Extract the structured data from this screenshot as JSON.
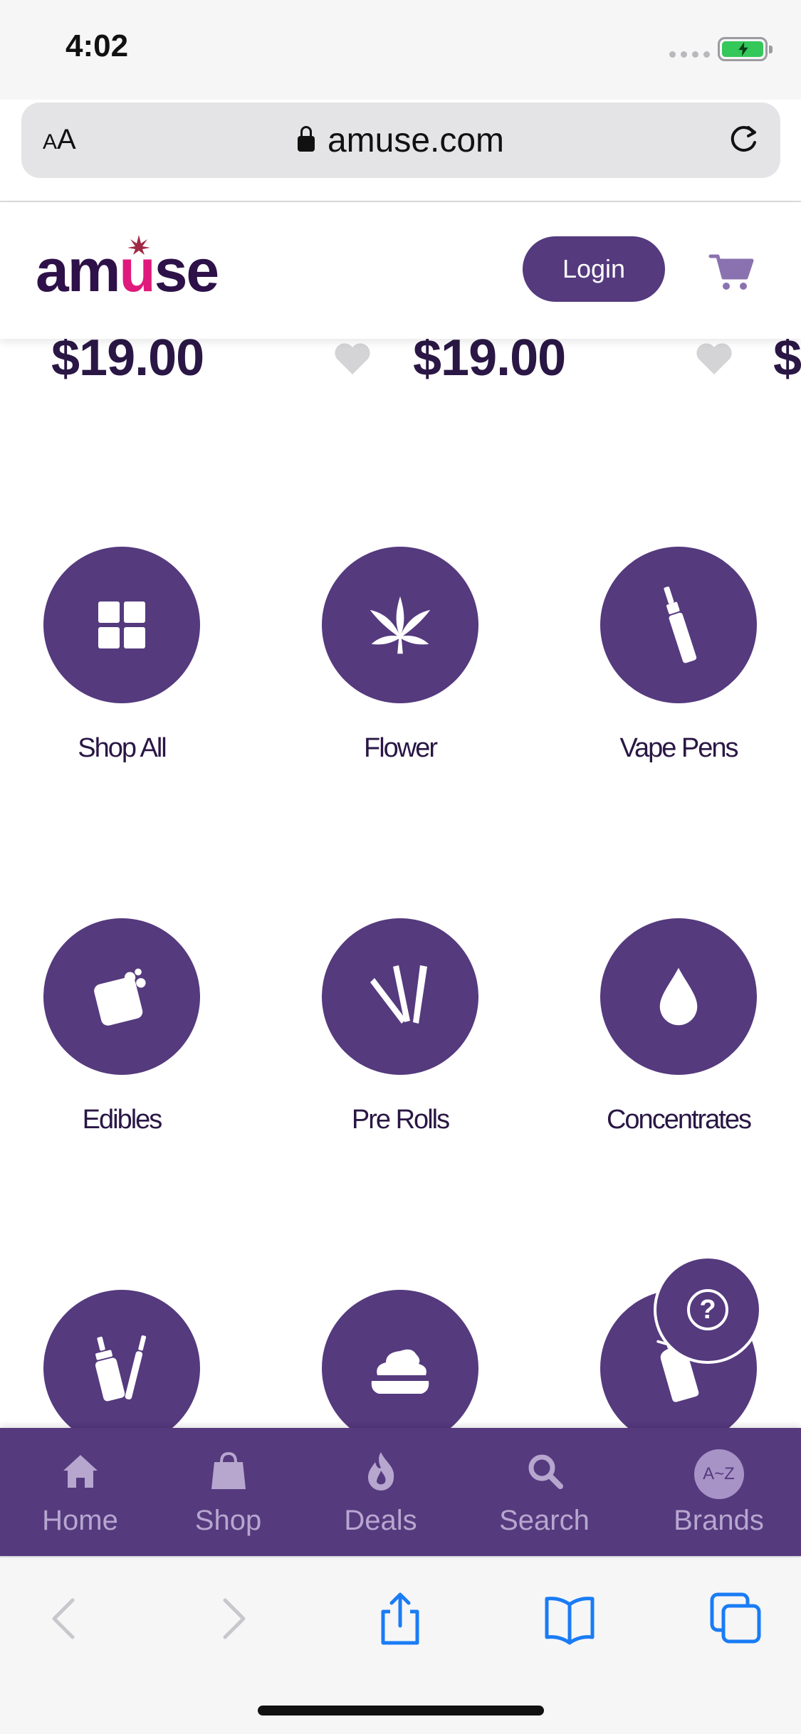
{
  "status": {
    "time": "4:02"
  },
  "browser": {
    "text_size_label_small": "A",
    "text_size_label_large": "A",
    "url": "amuse.com"
  },
  "site": {
    "logo_left": "am",
    "logo_u": "u",
    "logo_right": "se",
    "login_label": "Login"
  },
  "products": {
    "prices": [
      "$19.00",
      "$19.00",
      "$"
    ]
  },
  "categories": [
    {
      "label": "Shop All",
      "icon": "grid-icon"
    },
    {
      "label": "Flower",
      "icon": "leaf-icon"
    },
    {
      "label": "Vape Pens",
      "icon": "vape-pen-icon"
    },
    {
      "label": "Edibles",
      "icon": "edible-icon"
    },
    {
      "label": "Pre Rolls",
      "icon": "pre-roll-icon"
    },
    {
      "label": "Concentrates",
      "icon": "drop-icon"
    },
    {
      "label": "",
      "icon": "tincture-icon"
    },
    {
      "label": "",
      "icon": "topical-icon"
    },
    {
      "label": "",
      "icon": "bottle-icon"
    }
  ],
  "tabs": [
    {
      "label": "Home",
      "icon": "home-icon"
    },
    {
      "label": "Shop",
      "icon": "shopping-bag-icon"
    },
    {
      "label": "Deals",
      "icon": "flame-icon"
    },
    {
      "label": "Search",
      "icon": "search-icon"
    },
    {
      "label": "Brands",
      "icon": "az-icon",
      "badge": "A~Z"
    }
  ],
  "colors": {
    "brand_purple": "#553a7e",
    "logo_accent": "#e0197d",
    "tab_label": "#b7a7cf"
  }
}
